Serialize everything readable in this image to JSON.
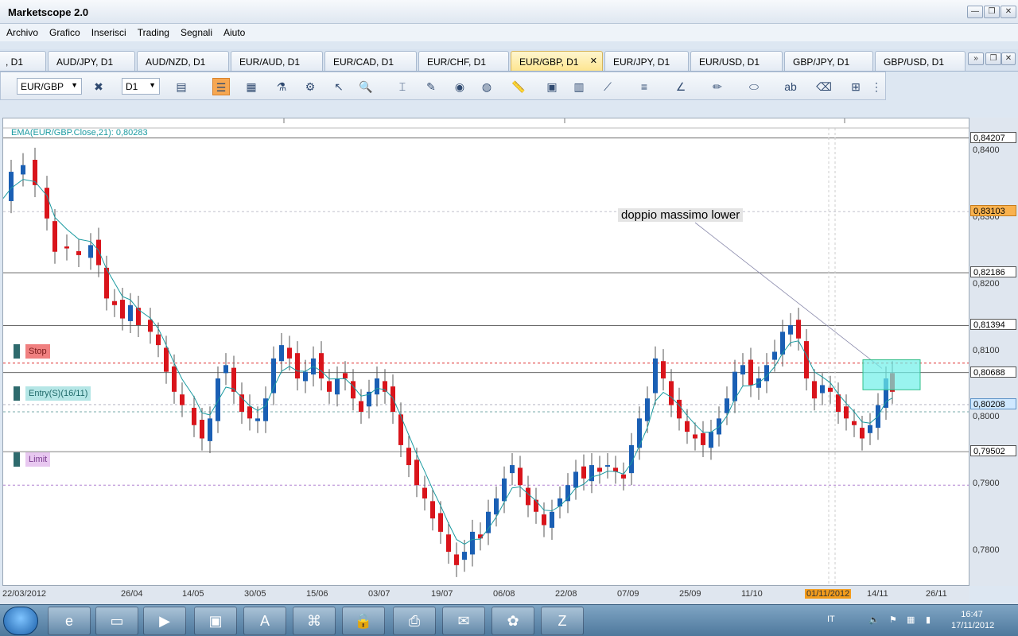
{
  "window": {
    "title": "Marketscope 2.0",
    "min": "—",
    "max": "❐",
    "close": "✕"
  },
  "menu": [
    "Archivo",
    "Grafico",
    "Inserisci",
    "Trading",
    "Segnali",
    "Aiuto"
  ],
  "tabs": [
    {
      "label": ", D1",
      "active": false
    },
    {
      "label": "AUD/JPY, D1",
      "active": false
    },
    {
      "label": "AUD/NZD, D1",
      "active": false
    },
    {
      "label": "EUR/AUD, D1",
      "active": false
    },
    {
      "label": "EUR/CAD, D1",
      "active": false
    },
    {
      "label": "EUR/CHF, D1",
      "active": false
    },
    {
      "label": "EUR/GBP, D1",
      "active": true
    },
    {
      "label": "EUR/JPY, D1",
      "active": false
    },
    {
      "label": "EUR/USD, D1",
      "active": false
    },
    {
      "label": "GBP/JPY, D1",
      "active": false
    },
    {
      "label": "GBP/USD, D1",
      "active": false
    }
  ],
  "toolbar": {
    "symbol": "EUR/GBP",
    "timeframe": "D1"
  },
  "chart": {
    "ema_label": "EMA(EUR/GBP.Close,21): 0,80283",
    "annotation": "doppio massimo lower",
    "orders": {
      "stop": "Stop",
      "entry": "Entry(S)(16/11)",
      "limit": "Limit"
    },
    "price_min": 0.775,
    "price_max": 0.845,
    "y_ticks": [
      "0,8400",
      "0,8300",
      "0,8200",
      "0,8100",
      "0,8000",
      "0,7900",
      "0,7800"
    ],
    "y_tags": [
      {
        "text": "0,84207",
        "value": 0.84207,
        "style": "plain"
      },
      {
        "text": "0,83103",
        "value": 0.83103,
        "style": "orange"
      },
      {
        "text": "0,82186",
        "value": 0.82186,
        "style": "plain"
      },
      {
        "text": "0,81394",
        "value": 0.81394,
        "style": "plain"
      },
      {
        "text": "0,80688",
        "value": 0.80688,
        "style": "plain"
      },
      {
        "text": "0,80208",
        "value": 0.80208,
        "style": "blue"
      },
      {
        "text": "0,79502",
        "value": 0.79502,
        "style": "plain"
      }
    ],
    "x_ticks": [
      "22/03/2012",
      "26/04",
      "14/05",
      "30/05",
      "15/06",
      "03/07",
      "19/07",
      "06/08",
      "22/08",
      "07/09",
      "25/09",
      "11/10",
      "01/11/2012",
      "14/11",
      "26/11"
    ],
    "colors": {
      "bull": "#1a5fb4",
      "bear": "#d9141b",
      "ema": "#1a9aa0",
      "stop": "#e03030",
      "limit": "#b080d0"
    }
  },
  "taskbar": {
    "lang": "IT",
    "time": "16:47",
    "date": "17/11/2012",
    "apps": [
      "ie-icon",
      "explorer-icon",
      "media-icon",
      "app-3b-icon",
      "translate-icon",
      "pdf-icon",
      "lock-icon",
      "printer-icon",
      "notes-icon",
      "paint-icon",
      "marketscope-icon"
    ]
  }
}
